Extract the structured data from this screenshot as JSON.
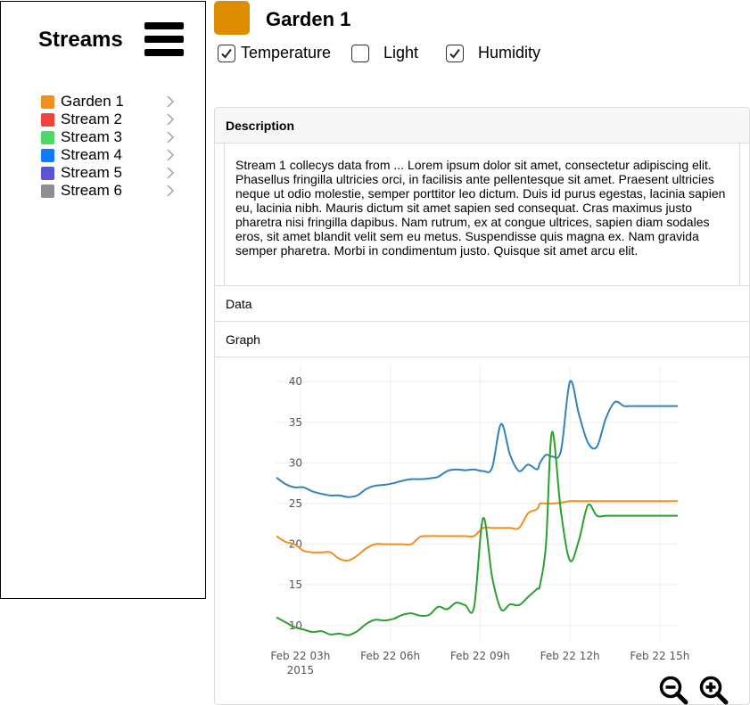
{
  "sidebar": {
    "title": "Streams",
    "items": [
      {
        "label": "Garden 1",
        "color": "#f28e1c"
      },
      {
        "label": "Stream 2",
        "color": "#f0443a"
      },
      {
        "label": "Stream 3",
        "color": "#4cd964"
      },
      {
        "label": "Stream 4",
        "color": "#0a7cff"
      },
      {
        "label": "Stream 5",
        "color": "#5856d6"
      },
      {
        "label": "Stream 6",
        "color": "#8e8e93"
      }
    ],
    "icons": {
      "menu": "hamburger-menu-icon",
      "item": "chevron-right-icon"
    }
  },
  "header": {
    "title": "Garden 1",
    "color": "#de8c00",
    "checkboxes": [
      {
        "label": "Temperature",
        "checked": true
      },
      {
        "label": "Light",
        "checked": false
      },
      {
        "label": "Humidity",
        "checked": true
      }
    ]
  },
  "panel": {
    "description_header": "Description",
    "description_text": "Stream 1 collecys data from ... Lorem ipsum dolor sit amet, consectetur adipiscing elit. Phasellus fringilla ultricies orci, in facilisis ante pellentesque sit amet. Praesent ultricies neque ut odio molestie, semper porttitor leo dictum. Duis id purus egestas, lacinia sapien eu, lacinia nibh. Mauris dictum sit amet sapien sed consequat. Cras maximus justo pharetra nisi fringilla dapibus. Nam rutrum, ex at congue ultrices, sapien diam sodales eros, sit amet blandit velit sem eu metus. Suspendisse quis magna ex. Nam gravida semper pharetra. Morbi in condimentum justo. Quisque sit amet arcu elit.",
    "data_header": "Data",
    "graph_header": "Graph"
  },
  "zoom": {
    "out_icon": "zoom-out-icon",
    "in_icon": "zoom-in-icon"
  },
  "chart_data": {
    "type": "line",
    "title": "",
    "xlabel": "",
    "ylabel": "",
    "ylim": [
      8,
      42
    ],
    "xlim": [
      2.2,
      15.6
    ],
    "grid": true,
    "x_ticks": [
      {
        "value": 3,
        "label": "Feb 22 03h",
        "sublabel": "2015"
      },
      {
        "value": 6,
        "label": "Feb 22 06h"
      },
      {
        "value": 9,
        "label": "Feb 22 09h"
      },
      {
        "value": 12,
        "label": "Feb 22 12h"
      },
      {
        "value": 15,
        "label": "Feb 22 15h"
      }
    ],
    "y_ticks": [
      10,
      15,
      20,
      25,
      30,
      35,
      40
    ],
    "x": [
      2.2,
      2.5,
      2.8,
      3.1,
      3.4,
      3.7,
      4.0,
      4.3,
      4.6,
      4.9,
      5.2,
      5.5,
      5.8,
      6.1,
      6.4,
      6.7,
      7.0,
      7.3,
      7.6,
      7.9,
      8.2,
      8.5,
      8.8,
      9.1,
      9.4,
      9.7,
      10.0,
      10.3,
      10.6,
      10.9,
      11.0,
      11.2,
      11.4,
      11.7,
      12.0,
      12.3,
      12.6,
      12.9,
      13.2,
      13.5,
      13.8,
      14.0,
      14.2,
      14.4,
      14.55,
      14.7,
      14.9,
      15.1,
      15.3,
      15.45,
      15.6
    ],
    "series": [
      {
        "color": "#3182bd",
        "values": [
          28.2,
          27.4,
          27.0,
          27.0,
          26.5,
          26.2,
          26.0,
          26.0,
          25.8,
          26.0,
          26.8,
          27.2,
          27.3,
          27.5,
          27.8,
          28.0,
          28.0,
          28.1,
          28.3,
          29.0,
          29.2,
          29.1,
          29.2,
          29.0,
          29.4,
          34.8,
          31.0,
          29.0,
          29.8,
          29.2,
          30.0,
          31.0,
          30.8,
          31.5,
          40.0,
          36.0,
          32.5,
          32.0,
          35.5,
          37.5,
          37.0,
          37.0,
          37.0,
          37.0,
          37.0,
          37.0,
          37.0,
          37.0,
          37.0,
          37.0,
          37.0
        ]
      },
      {
        "color": "#f28e1c",
        "values": [
          21.0,
          20.3,
          20.0,
          19.2,
          19.0,
          19.0,
          19.0,
          18.2,
          18.0,
          18.6,
          19.5,
          20.0,
          20.0,
          20.0,
          20.0,
          20.0,
          20.9,
          21.0,
          21.0,
          21.0,
          21.0,
          21.0,
          21.0,
          22.0,
          22.0,
          22.0,
          22.0,
          22.0,
          23.8,
          24.3,
          25.0,
          25.0,
          25.0,
          25.1,
          25.3,
          25.3,
          25.3,
          25.3,
          25.3,
          25.3,
          25.3,
          25.3,
          25.3,
          25.3,
          25.3,
          25.3,
          25.3,
          25.3,
          25.3,
          25.3,
          25.3
        ]
      },
      {
        "color": "#2ca02c",
        "values": [
          11.0,
          10.4,
          9.8,
          9.5,
          9.2,
          9.3,
          8.9,
          9.0,
          8.8,
          9.3,
          10.2,
          10.7,
          10.6,
          10.8,
          11.3,
          11.5,
          11.2,
          11.3,
          12.3,
          12.0,
          12.8,
          12.5,
          12.3,
          23.2,
          16.0,
          12.0,
          12.6,
          12.5,
          13.5,
          14.5,
          15.0,
          20.0,
          33.8,
          24.0,
          18.0,
          20.5,
          24.8,
          23.5,
          23.5,
          23.5,
          23.5,
          23.5,
          23.5,
          23.5,
          23.5,
          23.5,
          23.5,
          23.5,
          23.5,
          23.5,
          23.5
        ]
      }
    ]
  }
}
